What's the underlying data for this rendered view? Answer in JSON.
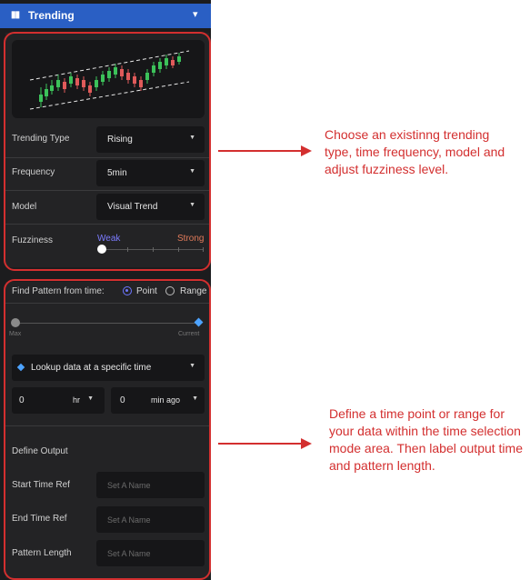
{
  "header": {
    "icon": "candlestick-icon",
    "title": "Trending",
    "chevron": "chevron-down-icon"
  },
  "trending": {
    "type_label": "Trending Type",
    "type_value": "Rising",
    "frequency_label": "Frequency",
    "frequency_value": "5min",
    "model_label": "Model",
    "model_value": "Visual Trend",
    "fuzziness_label": "Fuzziness",
    "fuzziness_weak": "Weak",
    "fuzziness_strong": "Strong",
    "fuzziness_level": 0.0
  },
  "pattern": {
    "find_label": "Find Pattern from time:",
    "option_point": "Point",
    "option_range": "Range",
    "selected": "Point",
    "slider_min_label": "Max",
    "slider_max_label": "Current",
    "lookup_label": "Lookup data at a specific time",
    "hr_value": "0",
    "hr_unit": "hr",
    "min_value": "0",
    "min_unit": "min ago",
    "define_output": "Define Output",
    "start_label": "Start Time Ref",
    "start_placeholder": "Set A Name",
    "end_label": "End Time Ref",
    "end_placeholder": "Set A Name",
    "length_label": "Pattern Length",
    "length_placeholder": "Set A Name"
  },
  "annotations": {
    "top": "Choose an existinng trending type, time frequency, model and adjust fuzziness level.",
    "bottom": "Define a time point or range for your data within the time selection mode area. Then label output time and pattern length."
  },
  "colors": {
    "accent": "#2a5fc4",
    "up": "#3cc25a",
    "down": "#e05a5a",
    "annotation": "#d32f2f",
    "radio": "#6e76ff"
  }
}
